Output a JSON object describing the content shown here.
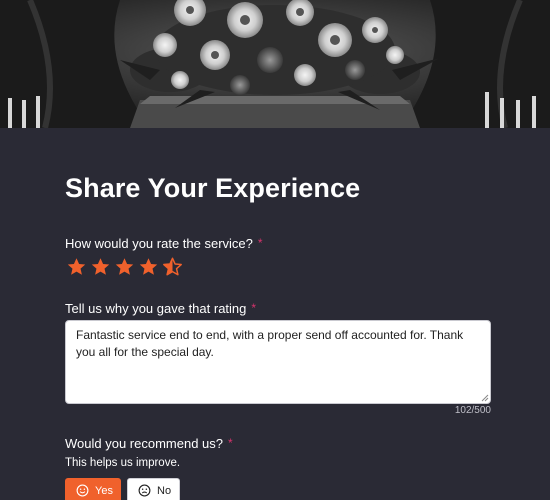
{
  "page": {
    "title": "Share Your Experience"
  },
  "rating_question": {
    "label": "How would you rate the service?",
    "required_mark": "*",
    "value": 4.5,
    "max": 5
  },
  "reason_question": {
    "label": "Tell us why you gave that rating",
    "required_mark": "*",
    "value": "Fantastic service end to end, with a proper send off accounted for. Thank you all for the special day.",
    "counter": "102/500"
  },
  "recommend_question": {
    "label": "Would you recommend us?",
    "required_mark": "*",
    "hint": "This helps us improve.",
    "yes_label": "Yes",
    "no_label": "No",
    "selected": "Yes"
  },
  "colors": {
    "accent": "#f0612c",
    "required": "#d6336c",
    "background": "#2a2a35"
  },
  "icons": {
    "star": "star-icon",
    "yes": "smile-icon",
    "no": "frown-icon"
  }
}
